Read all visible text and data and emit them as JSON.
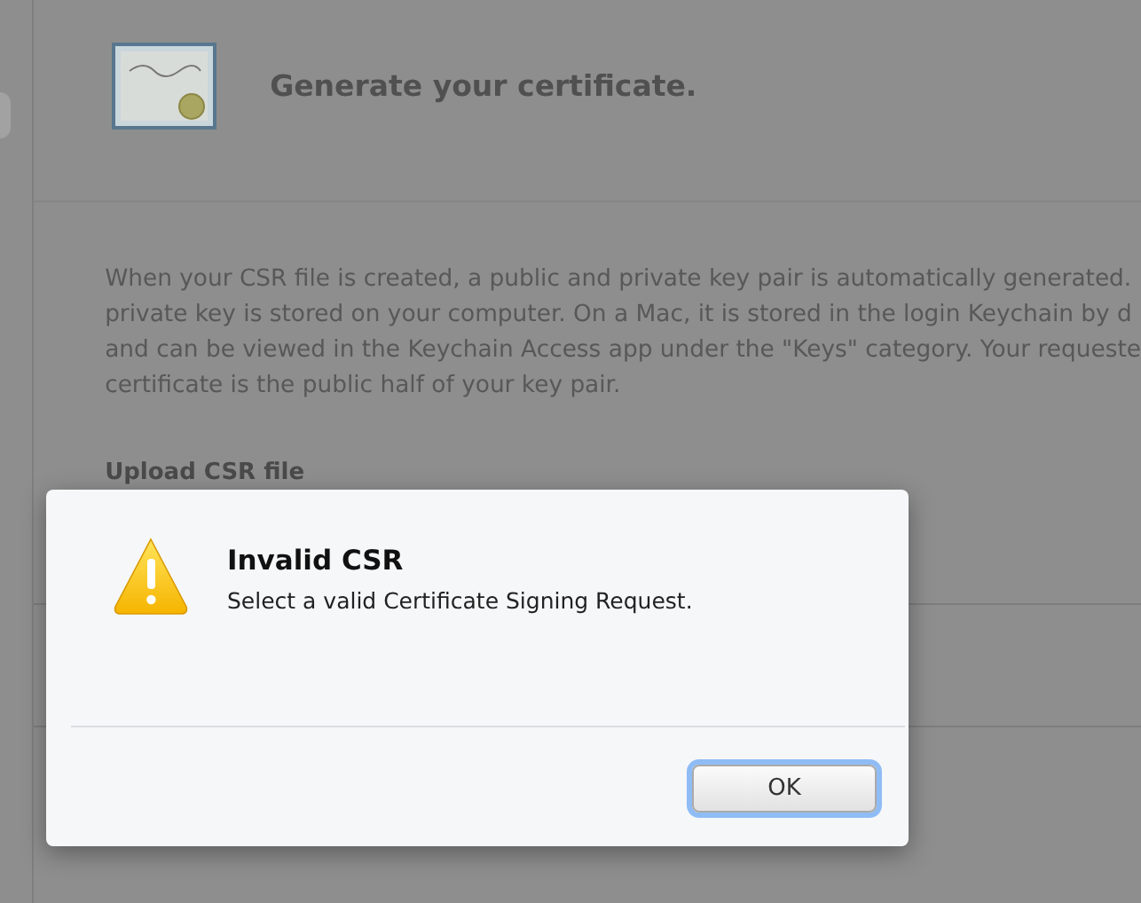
{
  "page": {
    "heading": "Generate your certificate.",
    "paragraph_lines": [
      "When your CSR file is created, a public and private key pair is automatically generated.",
      "private key is stored on your computer. On a Mac, it is stored in the login Keychain by d",
      "and can be viewed in the Keychain Access app under the \"Keys\" category. Your requeste",
      "certificate is the public half of your key pair."
    ],
    "upload_heading": "Upload CSR file"
  },
  "dialog": {
    "title": "Invalid CSR",
    "message": "Select a valid Certificate Signing Request.",
    "buttons": [
      {
        "label": "OK",
        "selected": true
      }
    ]
  }
}
